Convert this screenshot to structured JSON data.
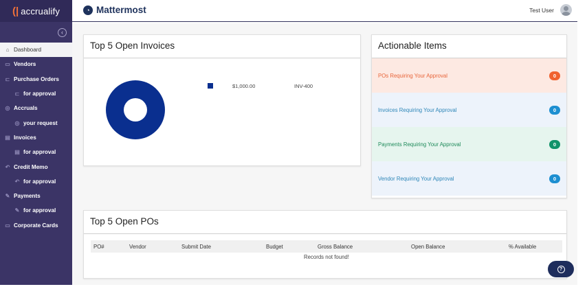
{
  "brand": {
    "mark": "(|",
    "name": "accrualify"
  },
  "sidebar": {
    "collapse_icon": "chevron-left-circle-icon",
    "items": [
      {
        "label": "Dashboard",
        "icon": "home-icon",
        "sub": false,
        "active": true
      },
      {
        "label": "Vendors",
        "icon": "vendors-icon",
        "sub": false
      },
      {
        "label": "Purchase Orders",
        "icon": "cart-icon",
        "sub": false
      },
      {
        "label": "for approval",
        "icon": "cart-icon",
        "sub": true
      },
      {
        "label": "Accruals",
        "icon": "globe-icon",
        "sub": false
      },
      {
        "label": "your request",
        "icon": "globe-icon",
        "sub": true
      },
      {
        "label": "Invoices",
        "icon": "invoice-icon",
        "sub": false
      },
      {
        "label": "for approval",
        "icon": "invoice-icon",
        "sub": true
      },
      {
        "label": "Credit Memo",
        "icon": "memo-icon",
        "sub": false
      },
      {
        "label": "for approval",
        "icon": "memo-icon",
        "sub": true
      },
      {
        "label": "Payments",
        "icon": "payment-icon",
        "sub": false
      },
      {
        "label": "for approval",
        "icon": "payment-icon",
        "sub": true
      },
      {
        "label": "Corporate Cards",
        "icon": "card-icon",
        "sub": false
      }
    ]
  },
  "topbar": {
    "logo_text": "Mattermost",
    "user_name": "Test User"
  },
  "invoices": {
    "title": "Top 5 Open Invoices",
    "legend": [
      {
        "amount": "$1,000.00",
        "id": "INV-400",
        "color": "#0a2f8f"
      }
    ],
    "chart_data": {
      "type": "pie",
      "categories": [
        "INV-400"
      ],
      "values": [
        1000
      ]
    }
  },
  "actionable": {
    "title": "Actionable Items",
    "rows": [
      {
        "label": "POs Requiring Your Approval",
        "count": "0",
        "bg": "#fde9e2",
        "fg": "#e8653a",
        "badge": "#f0622f"
      },
      {
        "label": "Invoices Requiring Your Approval",
        "count": "0",
        "bg": "#edf3fb",
        "fg": "#2d86b8",
        "badge": "#1d8fd1"
      },
      {
        "label": "Payments Requiring Your Approval",
        "count": "0",
        "bg": "#e6f5ee",
        "fg": "#1f8a5a",
        "badge": "#12936a"
      },
      {
        "label": "Vendor Requiring Your Approval",
        "count": "0",
        "bg": "#edf3fb",
        "fg": "#2d86b8",
        "badge": "#1d8fd1"
      }
    ]
  },
  "pos": {
    "title": "Top 5 Open POs",
    "columns": [
      "PO#",
      "Vendor",
      "Submit Date",
      "Budget",
      "Gross Balance",
      "Open Balance",
      "% Available"
    ],
    "empty_text": "Records not found!"
  },
  "help": {
    "icon": "question-icon"
  }
}
